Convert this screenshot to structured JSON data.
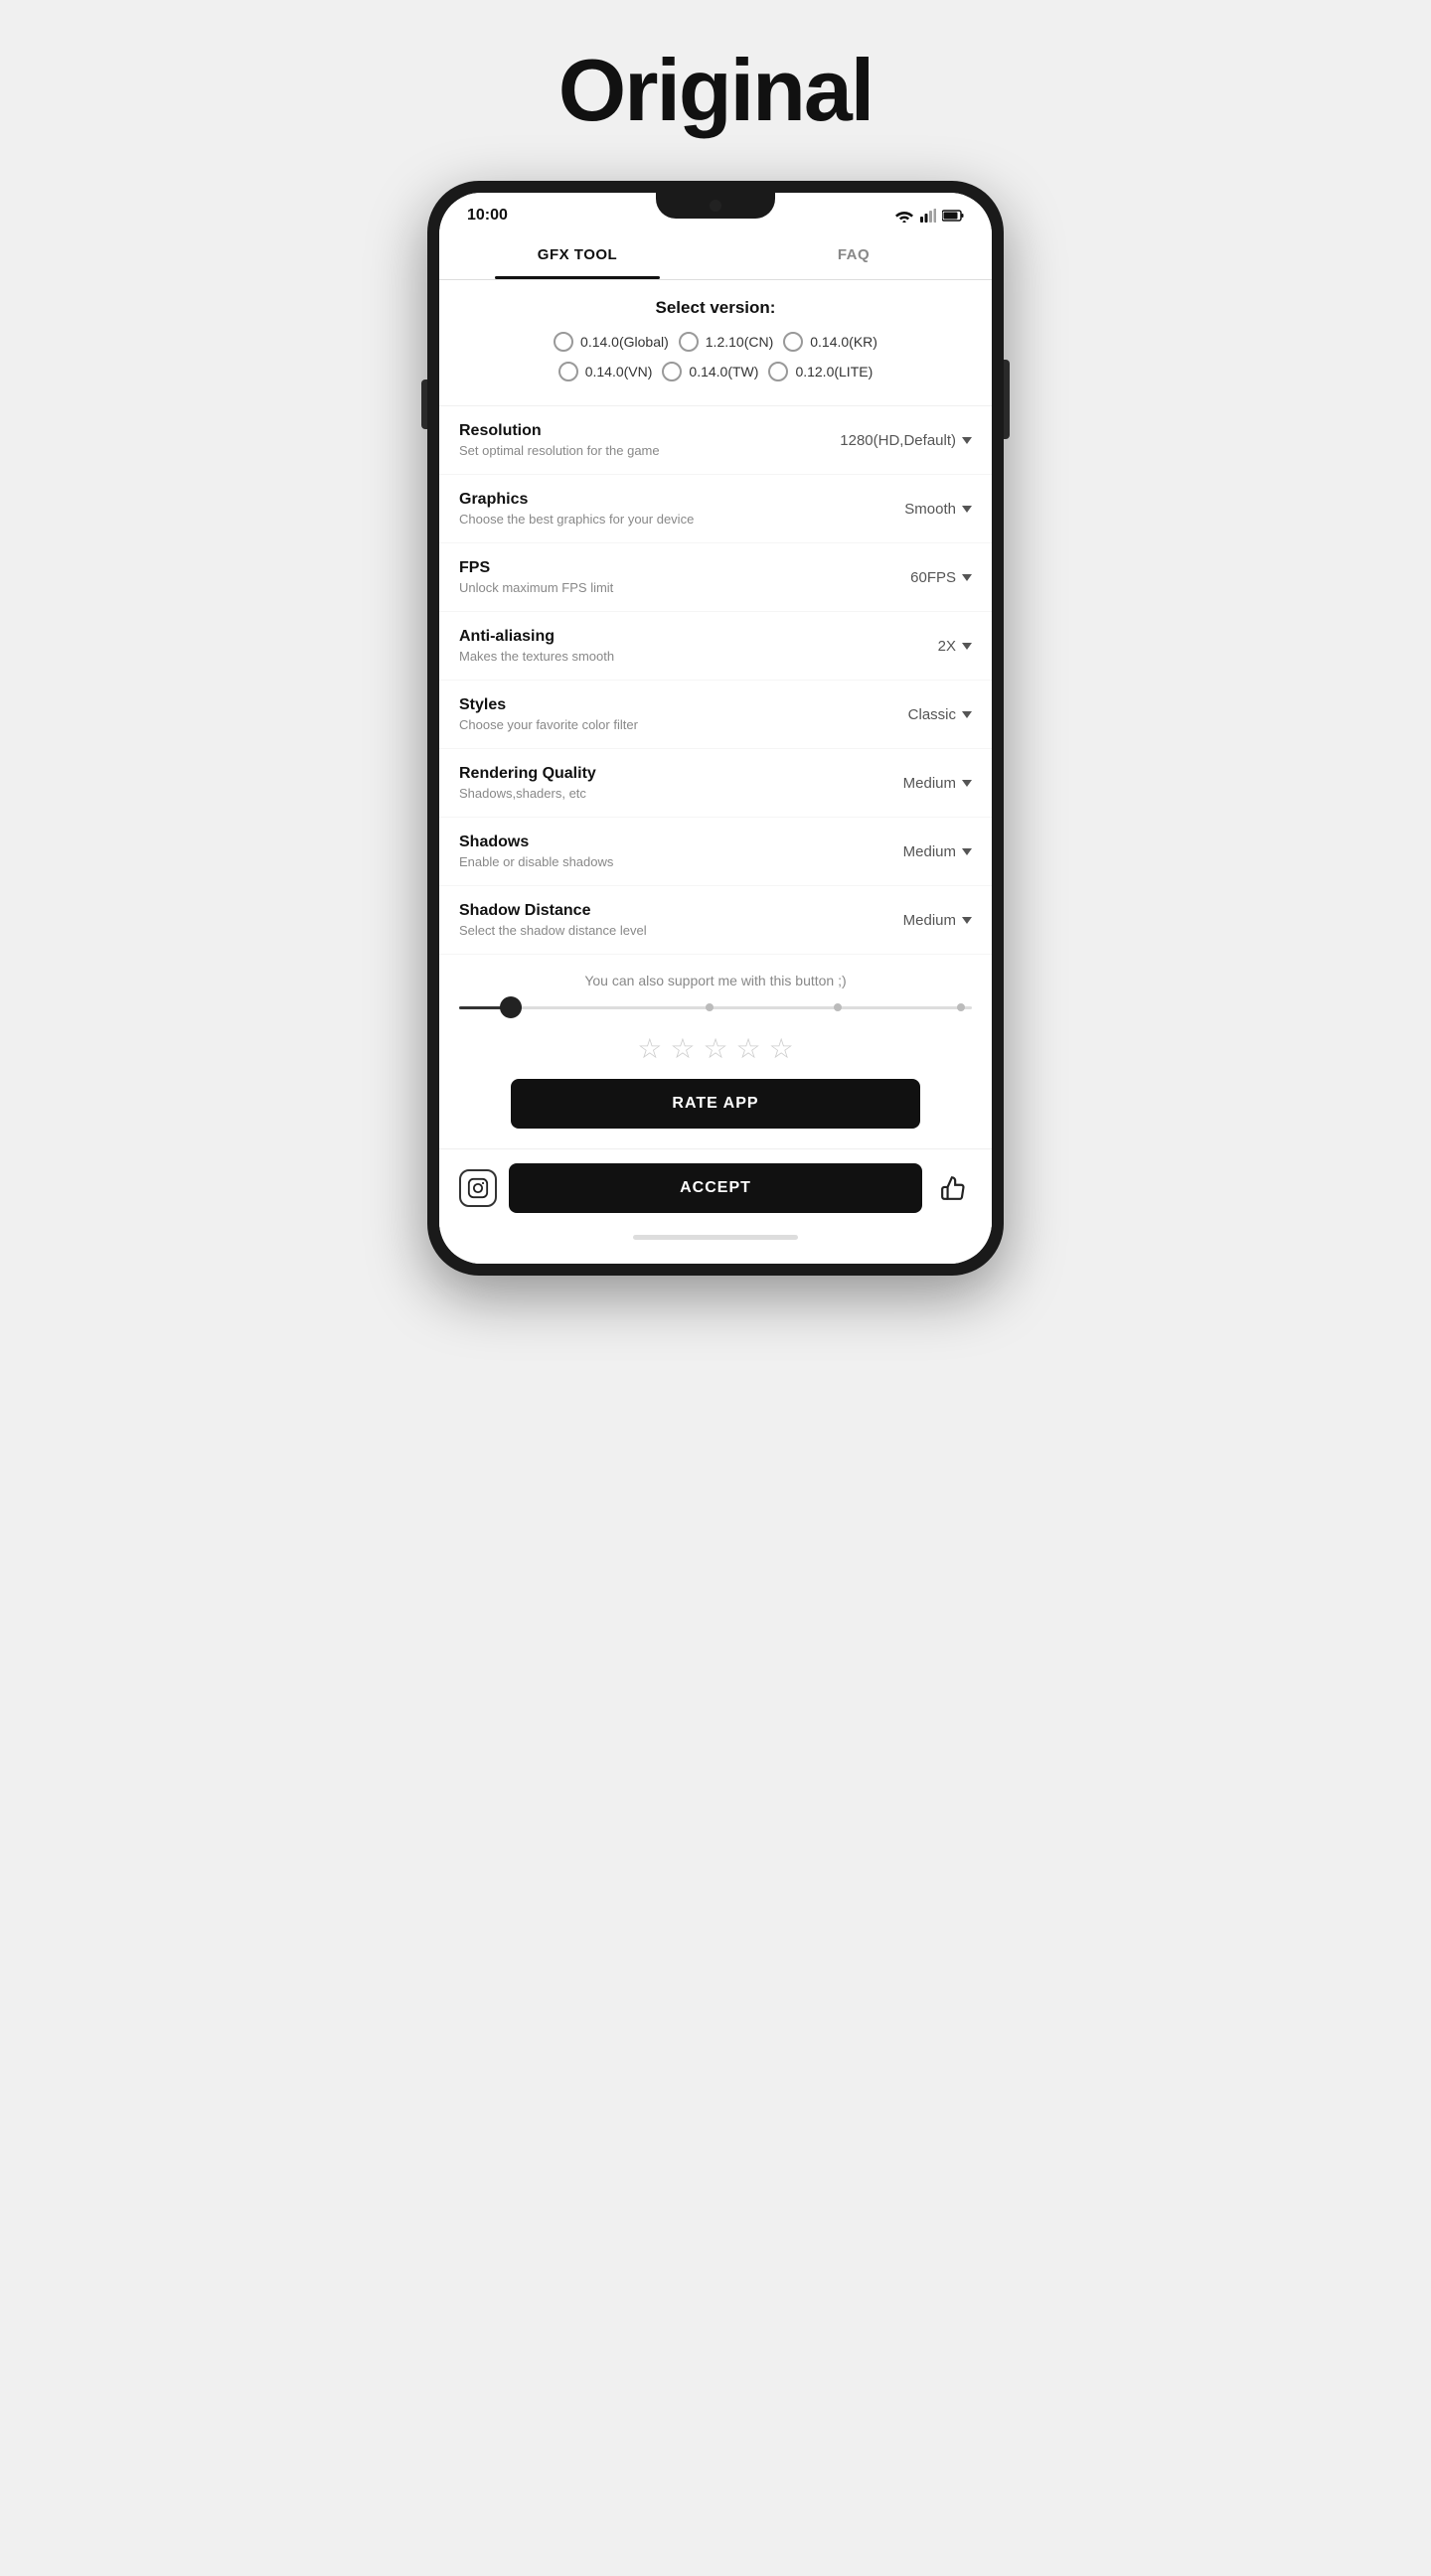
{
  "header": {
    "title": "Original"
  },
  "phone": {
    "status_time": "10:00"
  },
  "tabs": [
    {
      "label": "GFX TOOL",
      "active": true
    },
    {
      "label": "FAQ",
      "active": false
    }
  ],
  "version_section": {
    "title": "Select version:",
    "options": [
      {
        "label": "0.14.0(Global)"
      },
      {
        "label": "1.2.10(CN)"
      },
      {
        "label": "0.14.0(KR)"
      },
      {
        "label": "0.14.0(VN)"
      },
      {
        "label": "0.14.0(TW)"
      },
      {
        "label": "0.12.0(LITE)"
      }
    ]
  },
  "settings": [
    {
      "label": "Resolution",
      "desc": "Set optimal resolution for the game",
      "value": "1280(HD,Default)"
    },
    {
      "label": "Graphics",
      "desc": "Choose the best graphics for your device",
      "value": "Smooth"
    },
    {
      "label": "FPS",
      "desc": "Unlock maximum FPS limit",
      "value": "60FPS"
    },
    {
      "label": "Anti-aliasing",
      "desc": "Makes the textures smooth",
      "value": "2X"
    },
    {
      "label": "Styles",
      "desc": "Choose your favorite color filter",
      "value": "Classic"
    },
    {
      "label": "Rendering Quality",
      "desc": "Shadows,shaders, etc",
      "value": "Medium"
    },
    {
      "label": "Shadows",
      "desc": "Enable or disable shadows",
      "value": "Medium"
    },
    {
      "label": "Shadow Distance",
      "desc": "Select the shadow distance level",
      "value": "Medium"
    }
  ],
  "support": {
    "text": "You can also support me with this button ;)"
  },
  "rate_button": {
    "label": "RATE APP"
  },
  "accept_button": {
    "label": "ACCEPT"
  }
}
